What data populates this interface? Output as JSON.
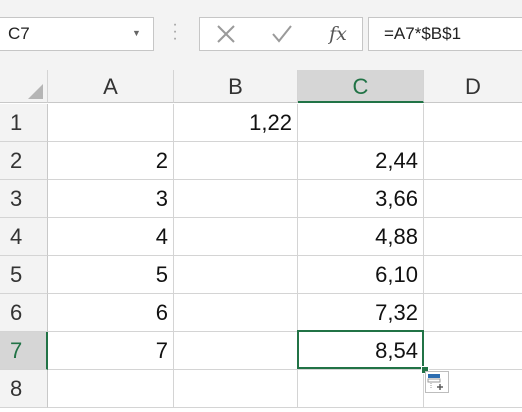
{
  "formula_bar": {
    "name_box": "C7",
    "dropdown_icon": "chevron-down-icon",
    "cancel_icon": "x-icon",
    "enter_icon": "checkmark-icon",
    "fx_label": "fx",
    "formula": "=A7*$B$1"
  },
  "columns": [
    "A",
    "B",
    "C",
    "D"
  ],
  "rows": [
    "1",
    "2",
    "3",
    "4",
    "5",
    "6",
    "7",
    "8"
  ],
  "cells": {
    "B1": "1,22",
    "A2": "2",
    "C2": "2,44",
    "A3": "3",
    "C3": "3,66",
    "A4": "4",
    "C4": "4,88",
    "A5": "5",
    "C5": "6,10",
    "A6": "6",
    "C6": "7,32",
    "A7": "7",
    "C7": "8,54"
  },
  "selection": {
    "active_cell": "C7",
    "active_column": "C",
    "active_row": "7"
  },
  "colors": {
    "accent": "#217346",
    "header_bg": "#f3f3f3",
    "grid_line": "#d4d4d4"
  }
}
